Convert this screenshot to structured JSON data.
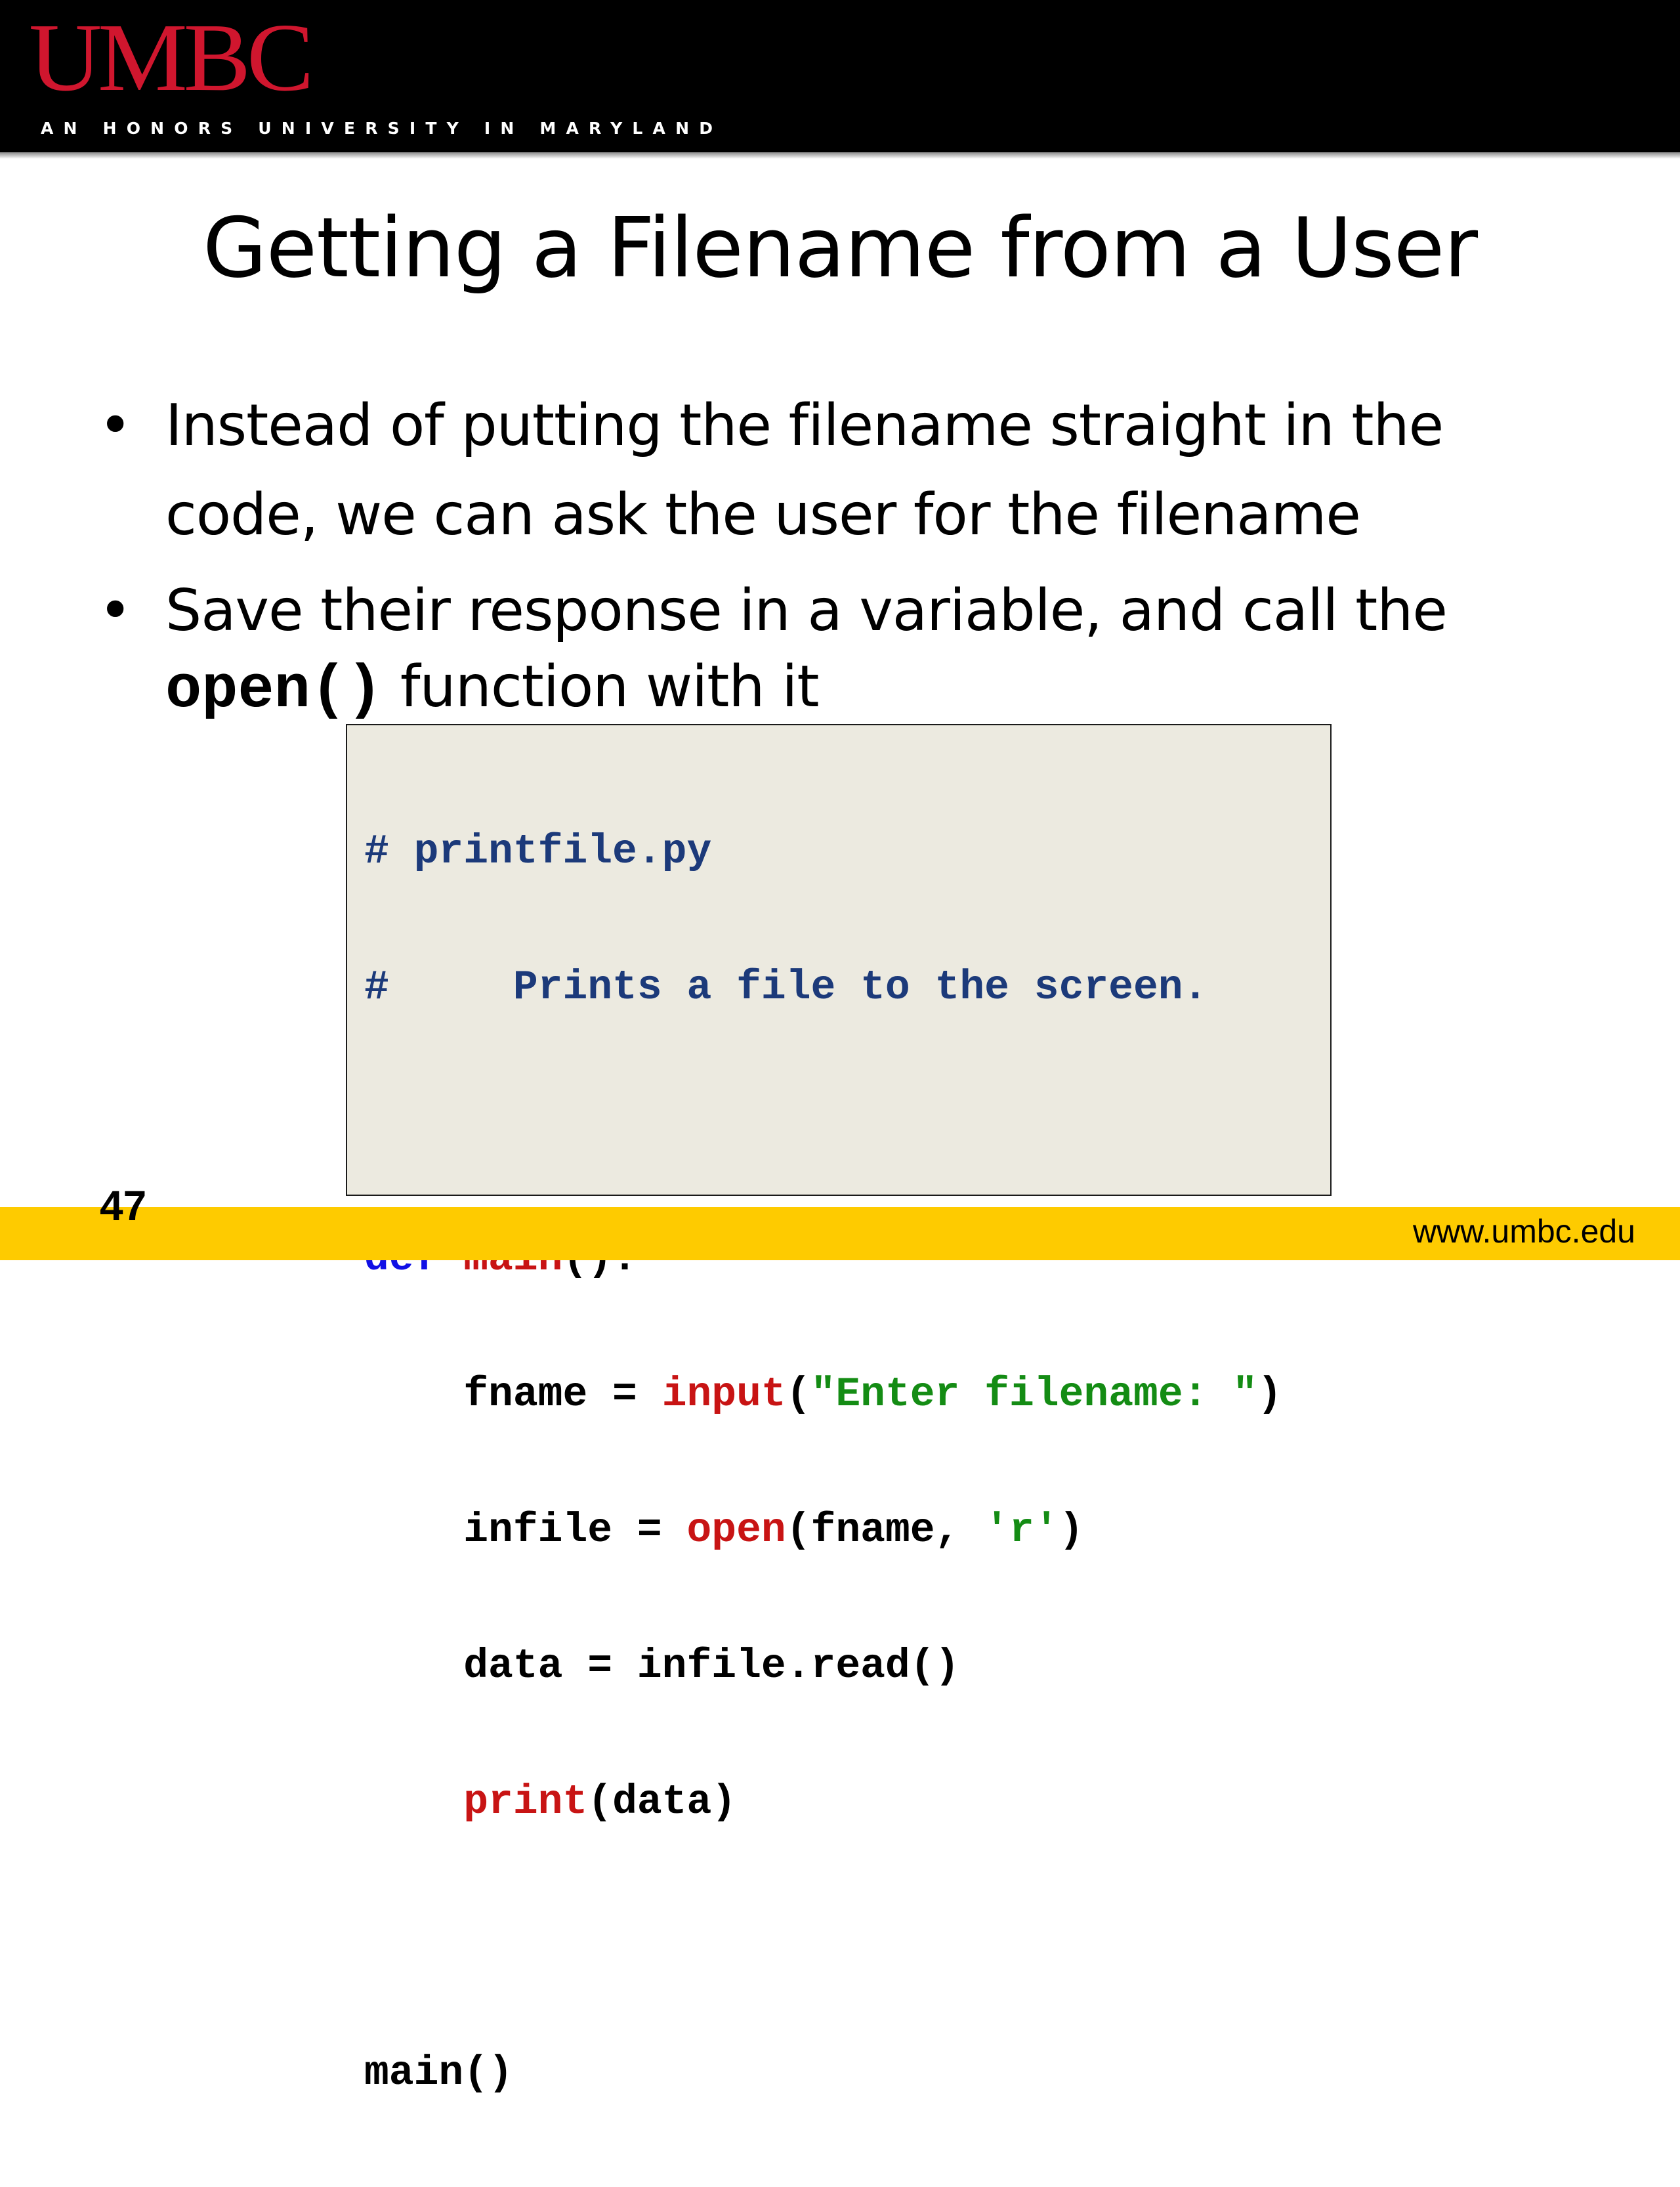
{
  "header": {
    "logo": "UMBC",
    "tagline": "AN HONORS UNIVERSITY IN MARYLAND"
  },
  "slide": {
    "title": "Getting a Filename from a User",
    "bullet1": "Instead of putting the filename straight in the code, we can ask the user for the filename",
    "bullet2_part1": "Save their response in a variable, and call the",
    "bullet2_code": "open()",
    "bullet2_part2": "function with it",
    "bullet_glyph": "•"
  },
  "code": {
    "line1": "# printfile.py",
    "line2": "#     Prints a file to the screen.",
    "line3_kw": "def",
    "line3_fn": "main",
    "line3_rest": "():",
    "line4_pre": "    fname = ",
    "line4_fn": "input",
    "line4_open": "(",
    "line4_str": "\"Enter filename: \"",
    "line4_close": ")",
    "line5_pre": "    infile = ",
    "line5_fn": "open",
    "line5_mid": "(fname, ",
    "line5_str": "'r'",
    "line5_close": ")",
    "line6": "    data = infile.read()",
    "line7_pre": "    ",
    "line7_fn": "print",
    "line7_rest": "(data)",
    "line8": "main()"
  },
  "footer": {
    "slide_number": "47",
    "url": "www.umbc.edu"
  },
  "colors": {
    "header_bg": "#000000",
    "logo": "#d0162e",
    "footer_bg": "#fecb00",
    "code_bg": "#eceae0",
    "comment": "#1c3a7a",
    "keyword": "#1010e6",
    "builtin": "#c81414",
    "string": "#148c14"
  }
}
